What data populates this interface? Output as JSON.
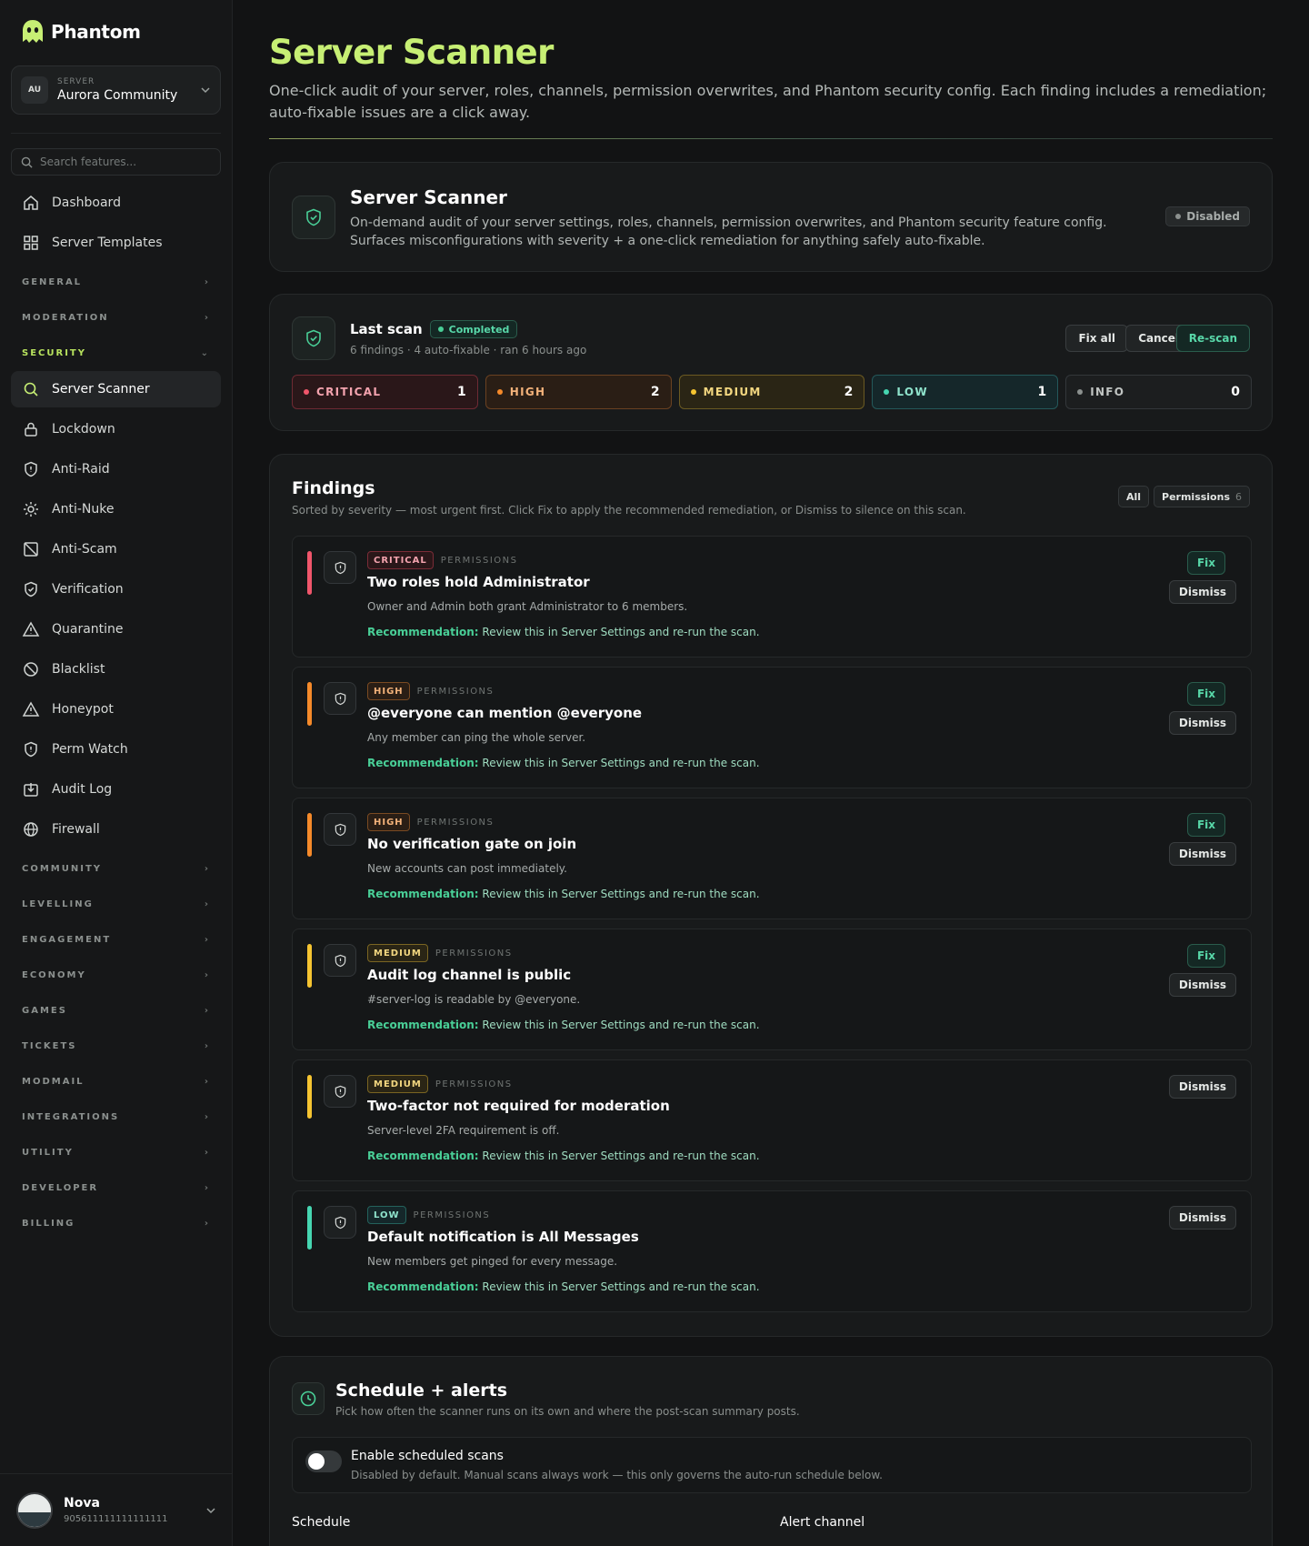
{
  "brand": {
    "name": "Phantom"
  },
  "server": {
    "label": "SERVER",
    "initials": "AU",
    "name": "Aurora Community"
  },
  "search": {
    "placeholder": "Search features..."
  },
  "nav": {
    "top": [
      {
        "label": "Dashboard",
        "icon": "home-icon"
      },
      {
        "label": "Server Templates",
        "icon": "grid-icon"
      }
    ],
    "sections": [
      "GENERAL",
      "MODERATION",
      "SECURITY",
      "COMMUNITY",
      "LEVELLING",
      "ENGAGEMENT",
      "ECONOMY",
      "GAMES",
      "TICKETS",
      "MODMAIL",
      "INTEGRATIONS",
      "UTILITY",
      "DEVELOPER",
      "BILLING"
    ],
    "security_items": [
      "Server Scanner",
      "Lockdown",
      "Anti-Raid",
      "Anti-Nuke",
      "Anti-Scam",
      "Verification",
      "Quarantine",
      "Blacklist",
      "Honeypot",
      "Perm Watch",
      "Audit Log",
      "Firewall"
    ]
  },
  "user": {
    "name": "Nova",
    "id": "905611111111111111"
  },
  "page": {
    "title": "Server Scanner",
    "subtitle": "One-click audit of your server, roles, channels, permission overwrites, and Phantom security config. Each finding includes a remediation; auto-fixable issues are a click away."
  },
  "feature_card": {
    "title": "Server Scanner",
    "desc": "On-demand audit of your server settings, roles, channels, permission overwrites, and Phantom security feature config. Surfaces misconfigurations with severity + a one-click remediation for anything safely auto-fixable.",
    "status": "Disabled"
  },
  "scan": {
    "title": "Last scan",
    "status": "Completed",
    "meta": "6 findings · 4 auto-fixable · ran 6 hours ago",
    "fix_all": "Fix all",
    "cancel": "Cancel",
    "rescan": "Re-scan",
    "severity": [
      {
        "label": "CRITICAL",
        "count": "1"
      },
      {
        "label": "HIGH",
        "count": "2"
      },
      {
        "label": "MEDIUM",
        "count": "2"
      },
      {
        "label": "LOW",
        "count": "1"
      },
      {
        "label": "INFO",
        "count": "0"
      }
    ]
  },
  "findings": {
    "title": "Findings",
    "subtitle": "Sorted by severity — most urgent first. Click Fix to apply the recommended remediation, or Dismiss to silence on this scan.",
    "filter_all": "All",
    "filter_permissions": "Permissions",
    "filter_permissions_count": "6",
    "fix_label": "Fix",
    "dismiss_label": "Dismiss",
    "rec_label": "Recommendation:",
    "items": [
      {
        "severity": "CRITICAL",
        "category": "PERMISSIONS",
        "title": "Two roles hold Administrator",
        "desc": "Owner and Admin both grant Administrator to 6 members.",
        "rec": "Review this in Server Settings and re-run the scan."
      },
      {
        "severity": "HIGH",
        "category": "PERMISSIONS",
        "title": "@everyone can mention @everyone",
        "desc": "Any member can ping the whole server.",
        "rec": "Review this in Server Settings and re-run the scan."
      },
      {
        "severity": "HIGH",
        "category": "PERMISSIONS",
        "title": "No verification gate on join",
        "desc": "New accounts can post immediately.",
        "rec": "Review this in Server Settings and re-run the scan."
      },
      {
        "severity": "MEDIUM",
        "category": "PERMISSIONS",
        "title": "Audit log channel is public",
        "desc": "#server-log is readable by @everyone.",
        "rec": "Review this in Server Settings and re-run the scan."
      },
      {
        "severity": "MEDIUM",
        "category": "PERMISSIONS",
        "title": "Two-factor not required for moderation",
        "desc": "Server-level 2FA requirement is off.",
        "rec": "Review this in Server Settings and re-run the scan."
      },
      {
        "severity": "LOW",
        "category": "PERMISSIONS",
        "title": "Default notification is All Messages",
        "desc": "New members get pinged for every message.",
        "rec": "Review this in Server Settings and re-run the scan."
      }
    ]
  },
  "schedule": {
    "title": "Schedule + alerts",
    "subtitle": "Pick how often the scanner runs on its own and where the post-scan summary posts.",
    "toggle_label": "Enable scheduled scans",
    "toggle_desc": "Disabled by default. Manual scans always work — this only governs the auto-run schedule below.",
    "toggle_on": false,
    "schedule_label": "Schedule",
    "alert_label": "Alert channel"
  },
  "colors": {
    "accent": "#c7ef74",
    "green": "#49cf97",
    "critical": "#f0566b",
    "high": "#f58a2a",
    "medium": "#f5c431",
    "low": "#46d6b1",
    "info": "#8b908e"
  }
}
